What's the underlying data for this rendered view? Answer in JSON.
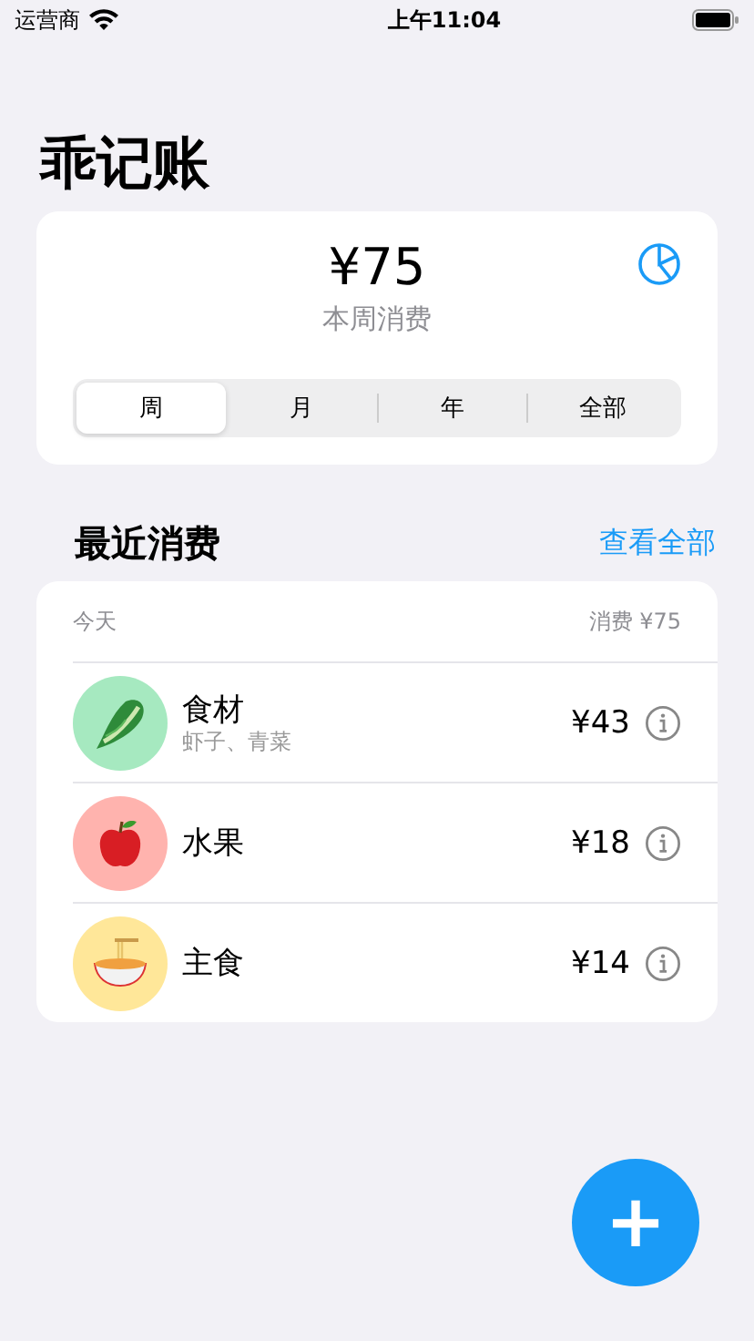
{
  "status_bar": {
    "carrier": "运营商",
    "time": "上午11:04"
  },
  "title": "乖记账",
  "summary": {
    "amount": "¥75",
    "label": "本周消费"
  },
  "periods": [
    {
      "label": "周",
      "selected": true
    },
    {
      "label": "月",
      "selected": false
    },
    {
      "label": "年",
      "selected": false
    },
    {
      "label": "全部",
      "selected": false
    }
  ],
  "recent": {
    "heading": "最近消费",
    "link": "查看全部"
  },
  "day": {
    "label": "今天",
    "total": "消费 ¥75"
  },
  "expenses": [
    {
      "kind": "vegetable",
      "color": "#a6e9c0",
      "name": "食材",
      "detail": "虾子、青菜",
      "amount": "¥43"
    },
    {
      "kind": "fruit",
      "color": "#ffb3ae",
      "name": "水果",
      "amount": "¥18"
    },
    {
      "kind": "noodles",
      "color": "#ffe799",
      "name": "主食",
      "amount": "¥14"
    }
  ],
  "fab": "+"
}
